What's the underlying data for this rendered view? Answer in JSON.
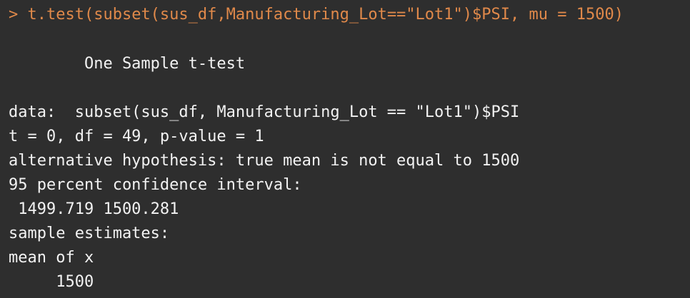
{
  "console": {
    "command_prompt": ">",
    "command": "t.test(subset(sus_df,Manufacturing_Lot==\"Lot1\")$PSI, mu = 1500)",
    "test_title": "        One Sample t-test",
    "data_line": "data:  subset(sus_df, Manufacturing_Lot == \"Lot1\")$PSI",
    "stats_line": "t = 0, df = 49, p-value = 1",
    "alt_line": "alternative hypothesis: true mean is not equal to 1500",
    "ci_label": "95 percent confidence interval:",
    "ci_values": " 1499.719 1500.281",
    "estimates_label": "sample estimates:",
    "estimate_name": "mean of x",
    "estimate_value": "     1500"
  },
  "colors": {
    "background": "#2e2e2e",
    "command": "#e0894a",
    "output": "#f2f2f2"
  }
}
